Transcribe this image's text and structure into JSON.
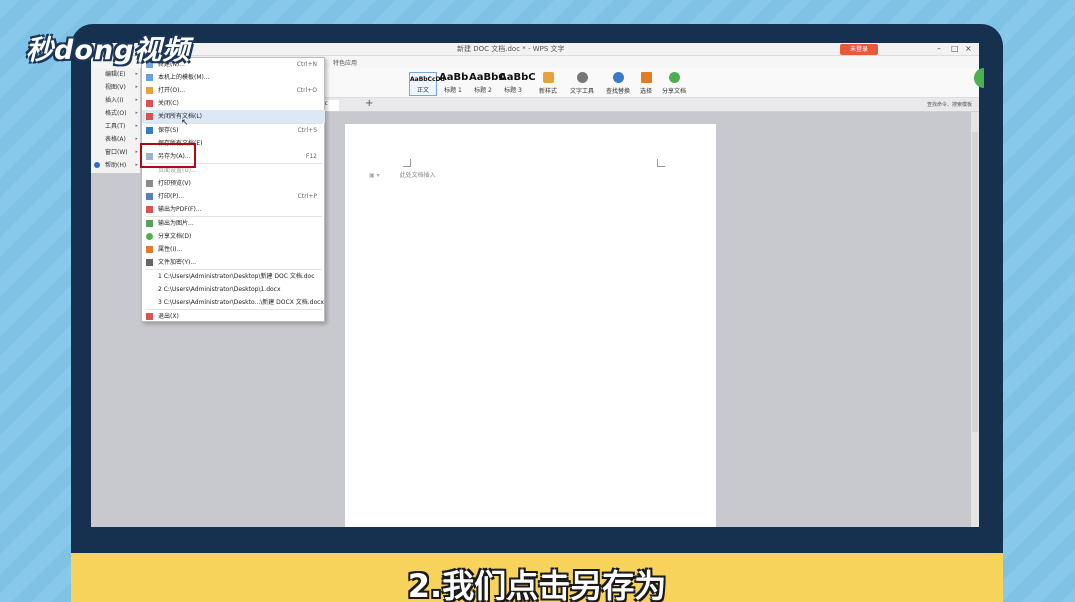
{
  "watermark": {
    "text": "秒dong视频"
  },
  "window": {
    "title": "新建 DOC 文档.doc * - WPS 文字",
    "login_label": "未登录",
    "controls": [
      "–",
      "□",
      "×"
    ]
  },
  "ribbon": {
    "tab_label": "特色应用",
    "styles": [
      {
        "preview": "AaBbCcDd",
        "label": "正文",
        "selected": true
      },
      {
        "preview": "AaBb",
        "label": "标题 1",
        "selected": false
      },
      {
        "preview": "AaBbC",
        "label": "标题 2",
        "selected": false
      },
      {
        "preview": "AaBbC",
        "label": "标题 3",
        "selected": false
      }
    ],
    "new_style_label": "新样式",
    "tools": [
      {
        "label": "文字工具",
        "color": "#777777"
      },
      {
        "label": "查找替换",
        "color": "#3a7bc8"
      },
      {
        "label": "选择",
        "color": "#e07b28"
      },
      {
        "label": "分享文档",
        "color": "#4caf50"
      }
    ],
    "search_text": "查找命令、搜索模板"
  },
  "doc_tab": {
    "label": "oc"
  },
  "left_menu": {
    "items": [
      "编辑(E)",
      "视图(V)",
      "插入(I)",
      "格式(O)",
      "工具(T)",
      "表格(A)",
      "窗口(W)",
      "帮助(H)"
    ]
  },
  "file_menu": {
    "items": [
      {
        "label": "新建(N)...",
        "shortcut": "Ctrl+N"
      },
      {
        "label": "本机上的模板(M)...",
        "shortcut": ""
      },
      {
        "label": "打开(O)...",
        "shortcut": "Ctrl+O"
      },
      {
        "label": "关闭(C)",
        "shortcut": ""
      },
      {
        "label": "关闭所有文档(L)",
        "shortcut": ""
      },
      {
        "label": "保存(S)",
        "shortcut": "Ctrl+S"
      },
      {
        "label": "保存所有文档(E)",
        "shortcut": ""
      },
      {
        "label": "另存为(A)...",
        "shortcut": "F12"
      },
      {
        "label": "页面设置(U)...",
        "shortcut": ""
      },
      {
        "label": "打印预览(V)",
        "shortcut": ""
      },
      {
        "label": "打印(P)...",
        "shortcut": "Ctrl+P"
      },
      {
        "label": "输出为PDF(F)...",
        "shortcut": ""
      },
      {
        "label": "输出为图片...",
        "shortcut": ""
      },
      {
        "label": "分享文档(D)",
        "shortcut": ""
      },
      {
        "label": "属性(I)...",
        "shortcut": ""
      },
      {
        "label": "文件加密(Y)...",
        "shortcut": ""
      },
      {
        "label": "1 C:\\Users\\Administrator\\Desktop\\新建 DOC 文档.doc",
        "shortcut": ""
      },
      {
        "label": "2 C:\\Users\\Administrator\\Desktop\\1.docx",
        "shortcut": ""
      },
      {
        "label": "3 C:\\Users\\Administrator\\Deskto...\\新建 DOCX 文档.docx",
        "shortcut": ""
      },
      {
        "label": "退出(X)",
        "shortcut": ""
      }
    ]
  },
  "document": {
    "hint": "此处文档插入"
  },
  "caption": {
    "text": "2.我们点击另存为"
  }
}
